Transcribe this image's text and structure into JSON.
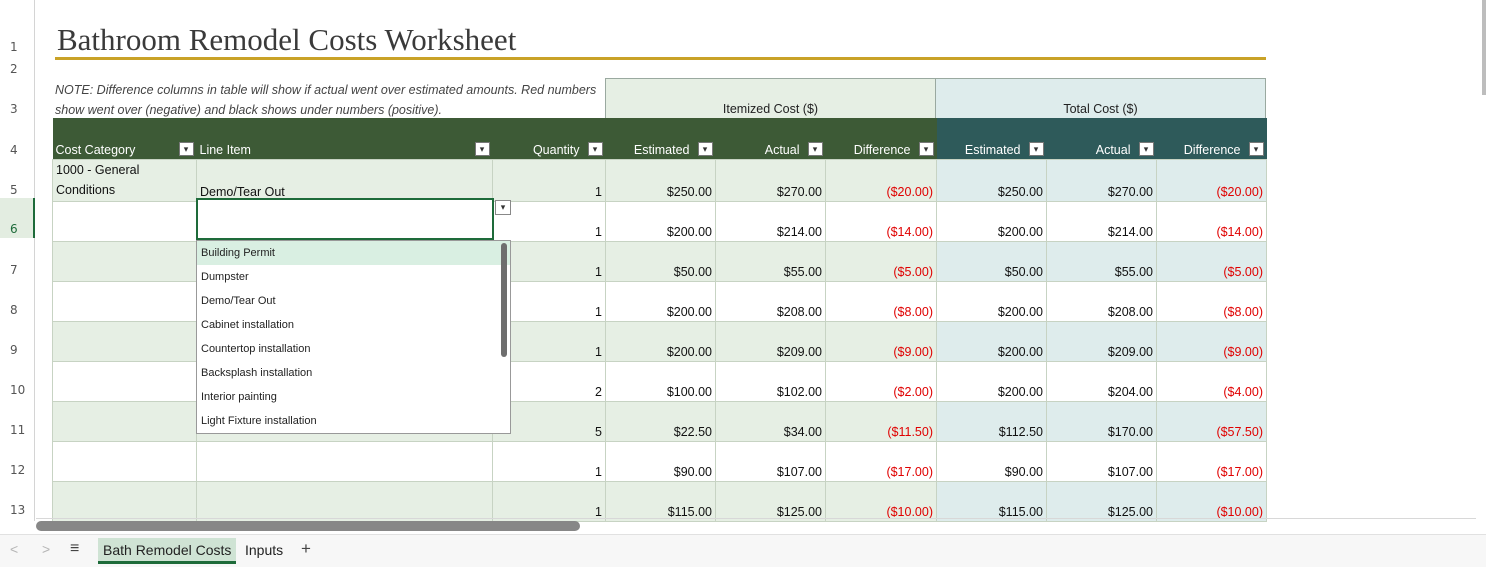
{
  "title": "Bathroom Remodel Costs Worksheet",
  "note": "NOTE: Difference columns in table will show if actual went over estimated amounts.  Red numbers show went over (negative) and black shows under numbers (positive).",
  "bands": {
    "itemized": "Itemized Cost ($)",
    "total": "Total Cost ($)"
  },
  "row_numbers": [
    "1",
    "2",
    "3",
    "4",
    "5",
    "6",
    "7",
    "8",
    "9",
    "10",
    "11",
    "12",
    "13"
  ],
  "headers": {
    "cost_category": "Cost Category",
    "line_item": "Line Item",
    "quantity": "Quantity",
    "est": "Estimated",
    "act": "Actual",
    "diff": "Difference",
    "t_est": "Estimated",
    "t_act": "Actual",
    "t_diff": "Difference"
  },
  "rows": [
    {
      "category": "1000 - General Conditions",
      "item": "Demo/Tear Out",
      "qty": "1",
      "est": "$250.00",
      "act": "$270.00",
      "diff": "($20.00)",
      "t_est": "$250.00",
      "t_act": "$270.00",
      "t_diff": "($20.00)"
    },
    {
      "category": "",
      "item": "",
      "qty": "1",
      "est": "$200.00",
      "act": "$214.00",
      "diff": "($14.00)",
      "t_est": "$200.00",
      "t_act": "$214.00",
      "t_diff": "($14.00)"
    },
    {
      "category": "",
      "item": "",
      "qty": "1",
      "est": "$50.00",
      "act": "$55.00",
      "diff": "($5.00)",
      "t_est": "$50.00",
      "t_act": "$55.00",
      "t_diff": "($5.00)"
    },
    {
      "category": "",
      "item": "",
      "qty": "1",
      "est": "$200.00",
      "act": "$208.00",
      "diff": "($8.00)",
      "t_est": "$200.00",
      "t_act": "$208.00",
      "t_diff": "($8.00)"
    },
    {
      "category": "",
      "item": "",
      "qty": "1",
      "est": "$200.00",
      "act": "$209.00",
      "diff": "($9.00)",
      "t_est": "$200.00",
      "t_act": "$209.00",
      "t_diff": "($9.00)"
    },
    {
      "category": "",
      "item": "",
      "qty": "2",
      "est": "$100.00",
      "act": "$102.00",
      "diff": "($2.00)",
      "t_est": "$200.00",
      "t_act": "$204.00",
      "t_diff": "($4.00)"
    },
    {
      "category": "",
      "item": "",
      "qty": "5",
      "est": "$22.50",
      "act": "$34.00",
      "diff": "($11.50)",
      "t_est": "$112.50",
      "t_act": "$170.00",
      "t_diff": "($57.50)"
    },
    {
      "category": "",
      "item": "",
      "qty": "1",
      "est": "$90.00",
      "act": "$107.00",
      "diff": "($17.00)",
      "t_est": "$90.00",
      "t_act": "$107.00",
      "t_diff": "($17.00)"
    },
    {
      "category": "",
      "item": "",
      "qty": "1",
      "est": "$115.00",
      "act": "$125.00",
      "diff": "($10.00)",
      "t_est": "$115.00",
      "t_act": "$125.00",
      "t_diff": "($10.00)"
    }
  ],
  "dropdown": {
    "options": [
      "Building Permit",
      "Dumpster",
      "Demo/Tear Out",
      "Cabinet installation",
      "Countertop installation",
      "Backsplash installation",
      "Interior painting",
      "Light Fixture installation"
    ],
    "highlighted": "Building Permit"
  },
  "sheet_tabs": {
    "active": "Bath Remodel Costs",
    "other": "Inputs"
  },
  "icons": {
    "prev": "chevron-left-icon",
    "next": "chevron-right-icon",
    "menu": "hamburger-icon",
    "add": "plus-icon",
    "filter": "filter-dropdown-icon"
  },
  "colors": {
    "header_green": "#3d5a36",
    "header_teal": "#2e5a5a",
    "negative": "#e00000",
    "title_rule": "#c9a227",
    "selection": "#1e6b3a"
  }
}
